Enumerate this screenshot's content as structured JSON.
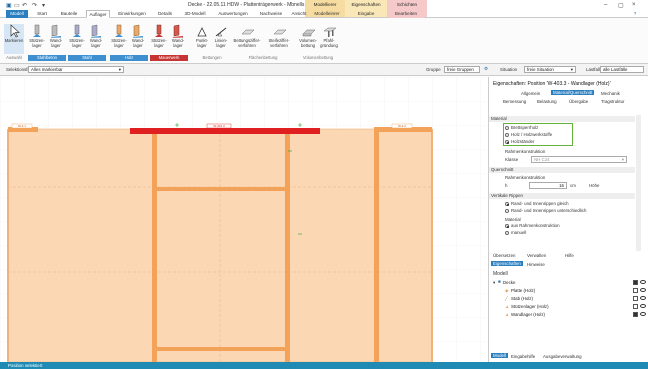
{
  "titlebar": {
    "title": "Decke - 22.05.11 HDW - Plattenträgerwerk - Mbnells 2022",
    "ctx_modellierer": "Modellierer",
    "ctx_eigenschaften": "Eigenschaften",
    "ctx_schichten": "Schichten",
    "ctx_modelleinrer": "Modelleinrer",
    "ctx_eingabe": "Eingabe",
    "ctx_bearbeiten": "Bearbeiten",
    "minimize": "–",
    "maximize": "▢",
    "close": "×",
    "help": "?"
  },
  "tabs": [
    "Modell",
    "Start",
    "Bauteile",
    "Auflager",
    "Einwirkungen",
    "Details",
    "3D-Modell",
    "Auswertungen",
    "Nachweise",
    "Ansicht"
  ],
  "ribbon": {
    "buttons": [
      {
        "label": "Markieren"
      },
      {
        "label": "Stützen-lager"
      },
      {
        "label": "Wand-lager"
      },
      {
        "label": "Stützen-lager"
      },
      {
        "label": "Wand-lager"
      },
      {
        "label": "Stützen-lager"
      },
      {
        "label": "Wand-lager"
      },
      {
        "label": "Stützen-lager"
      },
      {
        "label": "Wand-lager"
      },
      {
        "label": "Punkt-lager"
      },
      {
        "label": "Linien-lager"
      },
      {
        "label": "Bettungsziffer-verfahren"
      },
      {
        "label": "Steifeziffer-verfahren"
      },
      {
        "label": "Volumen-bettung"
      },
      {
        "label": "Pfahl-gründung"
      }
    ],
    "groups": [
      {
        "label": "Auswahl",
        "color": "#2f7fc1"
      },
      {
        "label": "Stahlbeton",
        "color": "#3d8fd0"
      },
      {
        "label": "Stahl",
        "color": "#3d8fd0"
      },
      {
        "label": "Holz",
        "color": "#3d8fd0"
      },
      {
        "label": "Mauerwerk",
        "color": "#c73434"
      },
      {
        "label": "Bettungen",
        "color": ""
      },
      {
        "label": "Flächenbettung",
        "color": ""
      },
      {
        "label": "Volumenbettung",
        "color": ""
      }
    ]
  },
  "optbar": {
    "select_label": "Selektionsfilter",
    "select_value": "Alles markierbar",
    "group_label": "Gruppe",
    "group_value": "freie Gruppen",
    "situation_label": "Situation",
    "situation_value": "freie Situation",
    "lastfall_label": "Lastfall",
    "lastfall_value": "alle Lastfälle"
  },
  "view": {
    "tag_top": "W-401.3",
    "tag_left": "W-4.1",
    "tag_right": "W-4.2"
  },
  "props": {
    "header": "Eigenschaften: Position 'W-403.3 - Wandlager (Holz)'",
    "tabs_row1": [
      "Allgemein",
      "Material/Querschnitt",
      "Mechanik"
    ],
    "tabs_row2": [
      "Bemessung",
      "Belastung",
      "Übergabe",
      "Tragstruktur"
    ],
    "section_material": "Material",
    "mat_options": [
      "Brettsperrholz",
      "Holz / Holzwerkstoffe",
      "Holzständer"
    ],
    "rahmenkonstruktion_label": "Rahmenkonstruktion",
    "klasse_label": "Klasse",
    "klasse_value": "NH C24",
    "section_querschnitt": "Querschnitt",
    "rahmenkonstruktion2": "Rahmenkonstruktion",
    "h_label": "h",
    "h_value": "16",
    "h_unit": "cm",
    "hoehe_label": "Höhe",
    "section_rippen": "Vertikale Rippen",
    "rippen_options": [
      "Rand- und Innenrippen gleich",
      "Rand- und Innenrippen unterschiedlich"
    ],
    "material2_label": "Material",
    "material2_options": [
      "aus Rahmenkonstruktion",
      "manuell"
    ],
    "bottom_tabs": [
      "Übersetzen",
      "Verwalten",
      "Hilfe"
    ],
    "bottom_tabs2": [
      "Eigenschaften",
      "Hinweise"
    ]
  },
  "model": {
    "header": "Modell",
    "root": "Decke",
    "items": [
      "Platte (Holz)",
      "Stab (Holz)",
      "Stützenlager (Holz)",
      "Wandlager (Holz)"
    ],
    "tabs": [
      "Modell",
      "Eingabehilfe",
      "Ausgabeverwaltung"
    ]
  },
  "status": {
    "text": "Position selektiert"
  }
}
